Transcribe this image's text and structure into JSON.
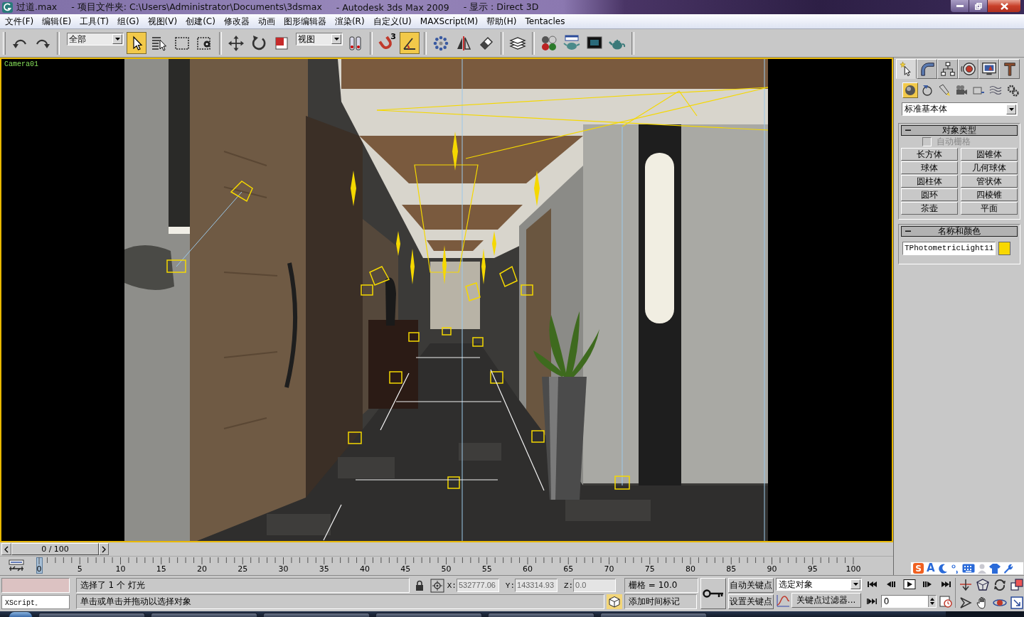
{
  "window": {
    "title_parts": [
      "过道.max",
      "- 项目文件夹: C:\\Users\\Administrator\\Documents\\3dsmax",
      "- Autodesk 3ds Max  2009",
      "- 显示 : Direct 3D"
    ]
  },
  "menu": [
    "文件(F)",
    "编辑(E)",
    "工具(T)",
    "组(G)",
    "视图(V)",
    "创建(C)",
    "修改器",
    "动画",
    "图形编辑器",
    "渲染(R)",
    "自定义(U)",
    "MAXScript(M)",
    "帮助(H)",
    "Tentacles"
  ],
  "toolbar": [
    {
      "kind": "button",
      "selected": false
    },
    {
      "kind": "button",
      "selected": false
    },
    {
      "kind": "separator"
    },
    {
      "kind": "dropdown",
      "value": "全部"
    },
    {
      "kind": "button",
      "selected": true
    },
    {
      "kind": "button",
      "selected": false
    },
    {
      "kind": "button",
      "selected": false
    },
    {
      "kind": "button",
      "selected": false
    },
    {
      "kind": "separator"
    },
    {
      "kind": "button",
      "selected": false
    },
    {
      "kind": "button",
      "selected": false
    },
    {
      "kind": "button",
      "selected": false
    },
    {
      "kind": "dropdown",
      "value": "视图"
    },
    {
      "kind": "button",
      "selected": false
    },
    {
      "kind": "separator"
    },
    {
      "kind": "button",
      "selected": false,
      "badge": "3"
    },
    {
      "kind": "button",
      "selected": true
    },
    {
      "kind": "separator"
    },
    {
      "kind": "button",
      "selected": false
    },
    {
      "kind": "button",
      "selected": false
    },
    {
      "kind": "button",
      "selected": false
    },
    {
      "kind": "separator"
    },
    {
      "kind": "button",
      "selected": false
    },
    {
      "kind": "separator"
    },
    {
      "kind": "button",
      "selected": false
    },
    {
      "kind": "button",
      "selected": false
    },
    {
      "kind": "button",
      "selected": false
    },
    {
      "kind": "button",
      "selected": false
    },
    {
      "kind": "separator"
    }
  ],
  "viewport": {
    "label": "Camera01",
    "active": true
  },
  "command_panel": {
    "tabs": [
      {
        "selected": true
      },
      {
        "selected": false
      },
      {
        "selected": false
      },
      {
        "selected": false
      },
      {
        "selected": false
      },
      {
        "selected": false
      }
    ],
    "categories": [
      {
        "selected": true
      },
      {
        "selected": false
      },
      {
        "selected": false
      },
      {
        "selected": false
      },
      {
        "selected": false
      },
      {
        "selected": false
      },
      {
        "selected": false
      }
    ],
    "object_category": "标准基本体",
    "rollouts": [
      {
        "kind": "object_type",
        "title": "对象类型",
        "expanded": true,
        "autogrid": {
          "label": "自动栅格",
          "checked": false,
          "disabled": true
        },
        "buttons": [
          "长方体",
          "圆锥体",
          "球体",
          "几何球体",
          "圆柱体",
          "管状体",
          "圆环",
          "四棱锥",
          "茶壶",
          "平面"
        ]
      },
      {
        "kind": "name_color",
        "title": "名称和颜色",
        "expanded": true,
        "name": "TPhotometricLight11",
        "color": "#f8d800"
      }
    ]
  },
  "ime_bar": {
    "logo": "S",
    "mode": "A"
  },
  "time_slider": {
    "label": "0 / 100",
    "level": 0
  },
  "track_bar": {
    "ticks": [
      "0",
      "5",
      "10",
      "15",
      "20",
      "25",
      "30",
      "35",
      "40",
      "45",
      "50",
      "55",
      "60",
      "65",
      "70",
      "75",
      "80",
      "85",
      "90",
      "95",
      "100"
    ]
  },
  "status": {
    "listener_input": "XScript。",
    "prompt": "选择了 1 个 灯光",
    "coords": [
      {
        "axis": "X:",
        "value": "532777.06"
      },
      {
        "axis": "Y:",
        "value": "143314.93"
      },
      {
        "axis": "Z:",
        "value": "0.0"
      }
    ],
    "grid": "栅格 = 10.0",
    "hint": "单击或单击并拖动以选择对象",
    "time_tag": "添加时间标记"
  },
  "animation": {
    "auto_key": {
      "label": "自动关键点",
      "on": false
    },
    "set_key": "设置关键点",
    "key_set": "选定对象",
    "key_filters": "关键点过滤器...",
    "frame": "0"
  }
}
